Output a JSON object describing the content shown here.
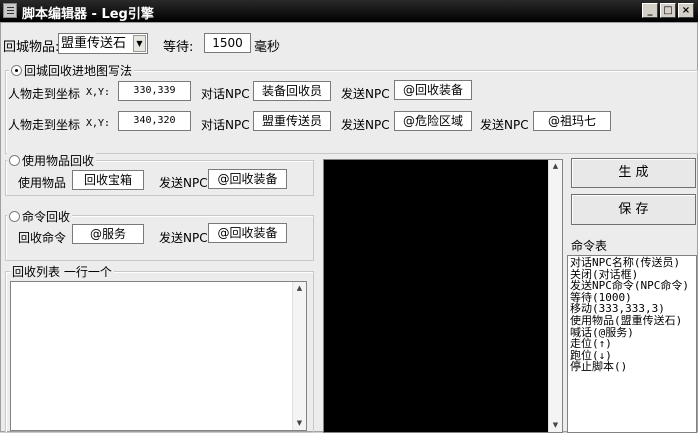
{
  "window": {
    "title": "脚本编辑器 - Leg引擎",
    "minimize": "_",
    "maximize": "□",
    "close": "×"
  },
  "top": {
    "return_item_label": "回城物品:",
    "return_item_value": "盟重传送石",
    "wait_label": "等待:",
    "wait_value": "1500",
    "wait_unit": "毫秒"
  },
  "map_section": {
    "title": "回城回收进地图写法",
    "row1": {
      "walk_label": "人物走到坐标",
      "xy_label": "X,Y:",
      "coords": "330,339",
      "npc_label": "对话NPC",
      "npc_value": "装备回收员",
      "send_label": "发送NPC",
      "send_value": "@回收装备"
    },
    "row2": {
      "walk_label": "人物走到坐标",
      "xy_label": "X,Y:",
      "coords": "340,320",
      "npc_label": "对话NPC",
      "npc_value": "盟重传送员",
      "send_label": "发送NPC",
      "send_value": "@危险区域",
      "send2_label": "发送NPC",
      "send2_value": "@祖玛七"
    }
  },
  "item_section": {
    "title": "使用物品回收",
    "use_label": "使用物品",
    "use_value": "回收宝箱",
    "send_label": "发送NPC",
    "send_value": "@回收装备"
  },
  "cmd_section": {
    "title": "命令回收",
    "cmd_label": "回收命令",
    "cmd_value": "@服务",
    "send_label": "发送NPC",
    "send_value": "@回收装备"
  },
  "recycle_list": {
    "title": "回收列表  一行一个"
  },
  "buttons": {
    "generate": "生 成",
    "save": "保 存"
  },
  "command_table": {
    "title": "命令表",
    "items": [
      "对话NPC名称(传送员)",
      "关闭(对话框)",
      "发送NPC命令(NPC命令)",
      "等待(1000)",
      "移动(333,333,3)",
      "使用物品(盟重传送石)",
      "喊话(@服务)",
      "走位(↑)",
      "跑位(↓)",
      "停止脚本()"
    ]
  }
}
